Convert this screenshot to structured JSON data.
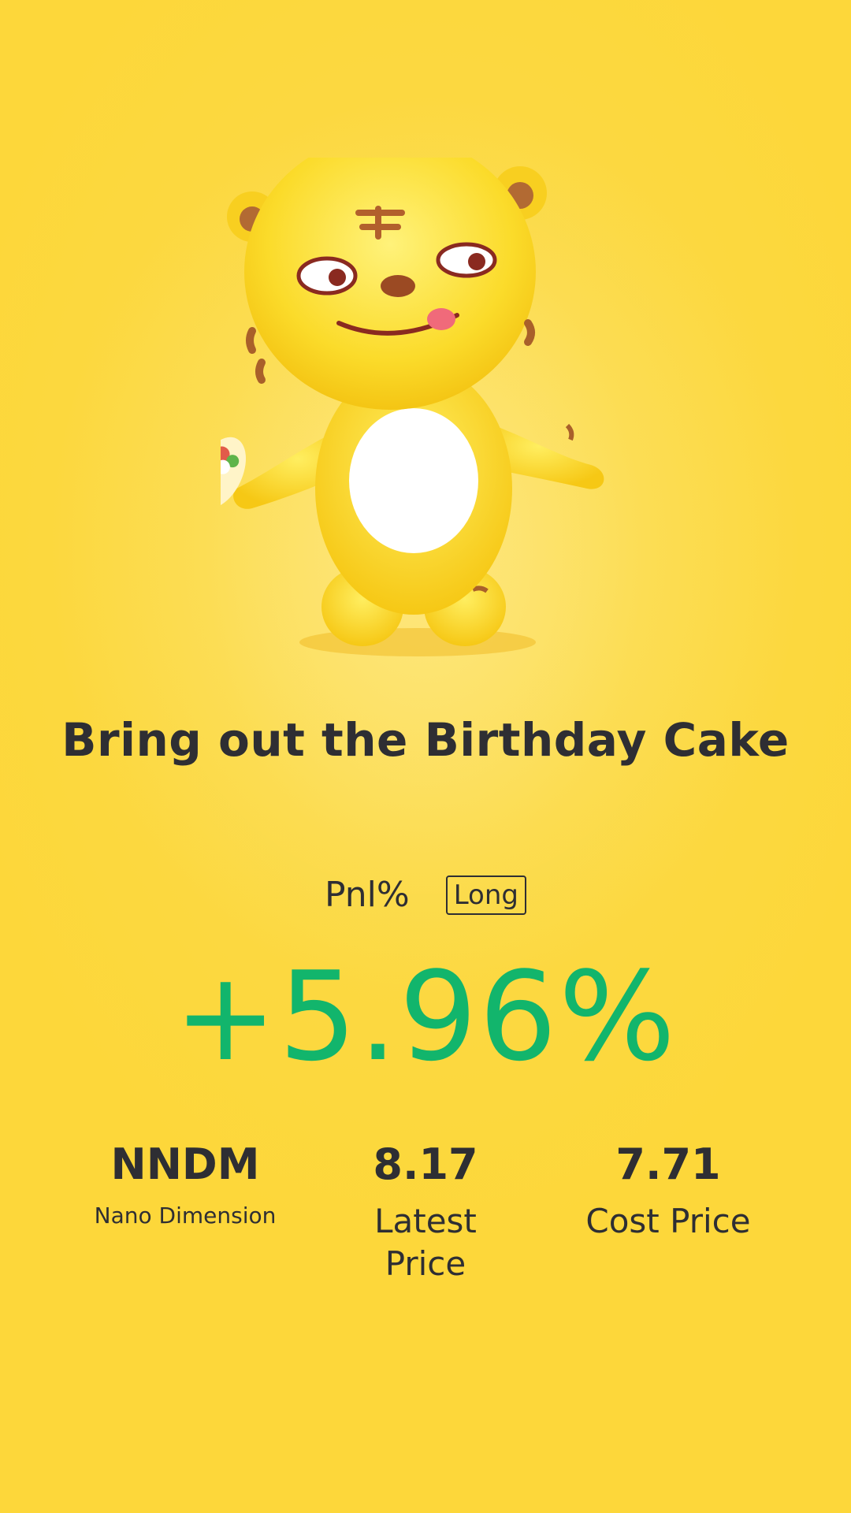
{
  "title": "Bring out the Birthday Cake",
  "pnl": {
    "label": "Pnl%",
    "badge": "Long",
    "value": "+5.96%"
  },
  "stats": {
    "symbol": {
      "value": "NNDM",
      "label": "Nano Dimension"
    },
    "latest": {
      "value": "8.17",
      "label": "Latest Price"
    },
    "cost": {
      "value": "7.71",
      "label": "Cost Price"
    }
  },
  "colors": {
    "background": "#fdd73a",
    "text": "#2e2e33",
    "positive": "#12b56c"
  },
  "icons": {
    "mascot": "tiger-mascot-icon"
  }
}
